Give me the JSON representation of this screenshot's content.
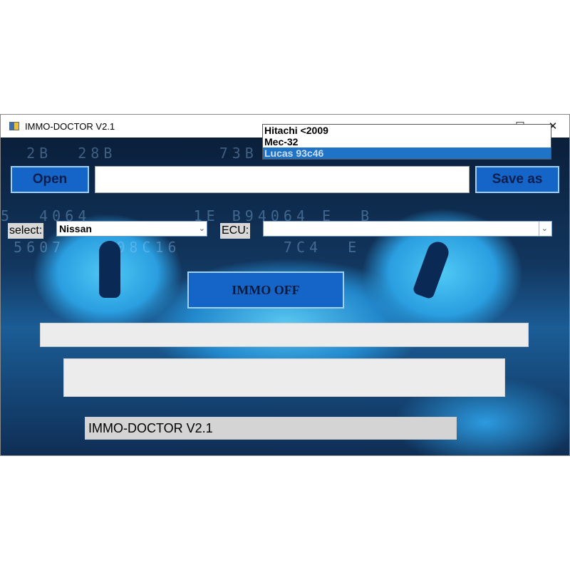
{
  "window": {
    "title": "IMMO-DOCTOR V2.1",
    "minimize": "—",
    "maximize": "☐",
    "close": "✕"
  },
  "toolbar": {
    "open_label": "Open",
    "file_path": "",
    "save_label": "Save as"
  },
  "select": {
    "label": "select:",
    "value": "Nissan"
  },
  "ecu": {
    "label": "ECU:",
    "value": "",
    "options": [
      "Hitachi <2009",
      "Mec-32",
      "Lucas 93c46"
    ],
    "highlighted": "Lucas 93c46"
  },
  "action": {
    "immo_off_label": "IMMO OFF"
  },
  "status": {
    "text": "IMMO-DOCTOR V2.1"
  },
  "colors": {
    "button": "#1565c8",
    "highlight": "#1f74c8"
  }
}
